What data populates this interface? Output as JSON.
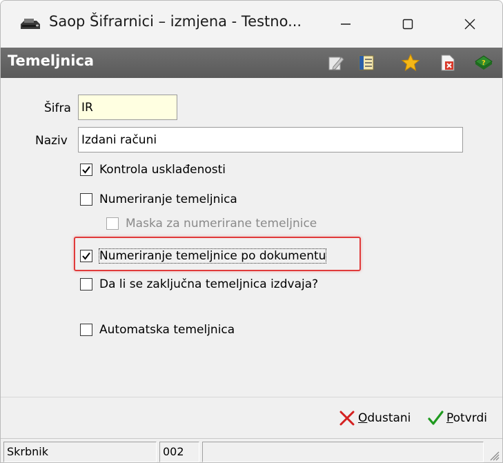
{
  "window": {
    "title": "Saop Šifrarnici – izmjena  - Testno...",
    "minimize": "—",
    "maximize": "☐",
    "close": "✕"
  },
  "header": {
    "title": "Temeljnica",
    "icons": [
      "edit-icon",
      "list-icon",
      "favorite-star-icon",
      "delete-document-icon",
      "help-book-icon"
    ]
  },
  "form": {
    "code_label": "Šifra",
    "code_value": "IR",
    "name_label": "Naziv",
    "name_value": "Izdani računi",
    "checkboxes": [
      {
        "label": "Kontrola usklađenosti",
        "checked": true,
        "enabled": true
      },
      {
        "label": "Numeriranje temeljnica",
        "checked": false,
        "enabled": true
      },
      {
        "label": "Maska za numerirane temeljnice",
        "checked": false,
        "enabled": false
      },
      {
        "label": "Numeriranje temeljnice po dokumentu",
        "checked": true,
        "enabled": true
      },
      {
        "label": "Da li se zaključna temeljnica izdvaja?",
        "checked": false,
        "enabled": true
      },
      {
        "label": "Automatska temeljnica",
        "checked": false,
        "enabled": true
      }
    ]
  },
  "actions": {
    "cancel_accel": "O",
    "cancel_rest": "dustani",
    "confirm_accel": "P",
    "confirm_rest": "otvrdi"
  },
  "status": {
    "user": "Skrbnik",
    "code": "002",
    "extra": ""
  },
  "colors": {
    "header_band": "#666666",
    "code_field_bg": "#ffffe1",
    "highlight": "#e03a3a",
    "cancel_x": "#d42020",
    "confirm_check": "#1f9a1f"
  }
}
